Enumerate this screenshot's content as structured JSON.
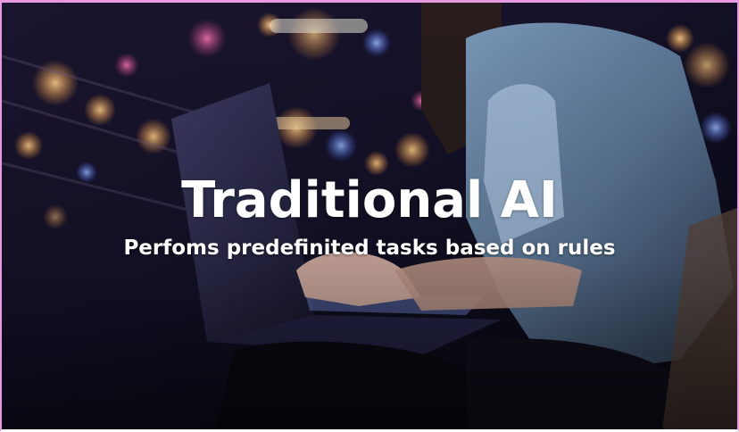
{
  "slide": {
    "title": "Traditional AI",
    "subtitle": "Perfoms predefinited tasks based on rules",
    "background_image": "person-typing-on-laptop-night-city-bokeh"
  },
  "colors": {
    "text": "#ffffff",
    "frame_border": "#e89ae0",
    "background_dark": "#0d0b1a"
  }
}
